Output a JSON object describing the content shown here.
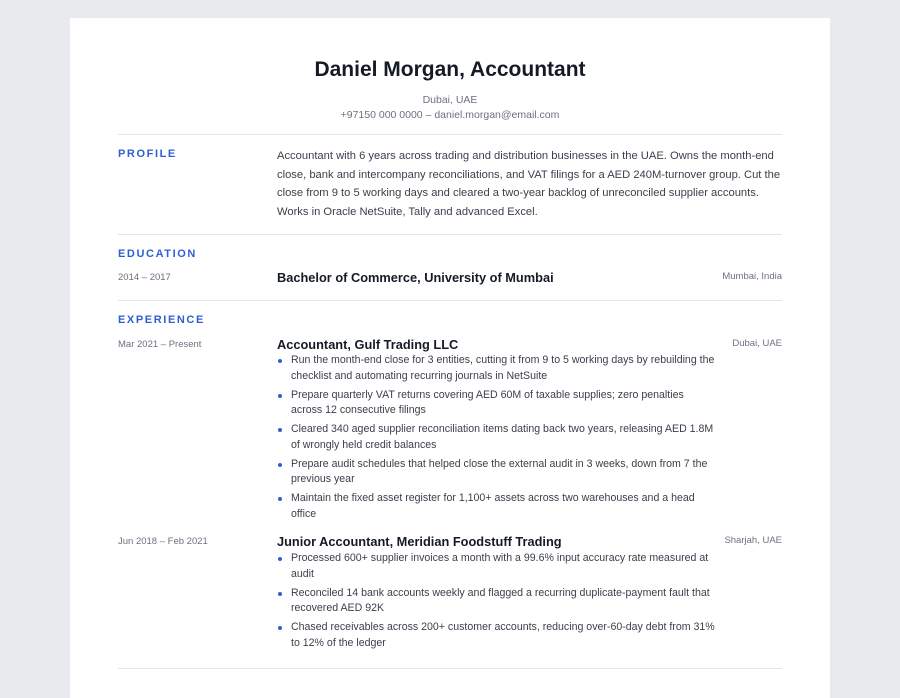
{
  "header": {
    "name": "Daniel Morgan, Accountant",
    "location": "Dubai, UAE",
    "contact": "+97150 000 0000 – daniel.morgan@email.com"
  },
  "profile": {
    "title": "PROFILE",
    "text": "Accountant with 6 years across trading and distribution businesses in the UAE. Owns the month-end close, bank and intercompany reconciliations, and VAT filings for a AED 240M-turnover group. Cut the close from 9 to 5 working days and cleared a two-year backlog of unreconciled supplier accounts. Works in Oracle NetSuite, Tally and advanced Excel."
  },
  "education": {
    "title": "EDUCATION",
    "items": [
      {
        "dates": "2014 – 2017",
        "degree": "Bachelor of Commerce, University of Mumbai",
        "location": "Mumbai, India"
      }
    ]
  },
  "experience": {
    "title": "EXPERIENCE",
    "jobs": [
      {
        "dates": "Mar 2021 – Present",
        "role": "Accountant, Gulf Trading LLC",
        "location": "Dubai, UAE",
        "bullets": [
          "Run the month-end close for 3 entities, cutting it from 9 to 5 working days by rebuilding the checklist and automating recurring journals in NetSuite",
          "Prepare quarterly VAT returns covering AED 60M of taxable supplies; zero penalties across 12 consecutive filings",
          "Cleared 340 aged supplier reconciliation items dating back two years, releasing AED 1.8M of wrongly held credit balances",
          "Prepare audit schedules that helped close the external audit in 3 weeks, down from 7 the previous year",
          "Maintain the fixed asset register for 1,100+ assets across two warehouses and a head office"
        ]
      },
      {
        "dates": "Jun 2018 – Feb 2021",
        "role": "Junior Accountant, Meridian Foodstuff Trading",
        "location": "Sharjah, UAE",
        "bullets": [
          "Processed 600+ supplier invoices a month with a 99.6% input accuracy rate measured at audit",
          "Reconciled 14 bank accounts weekly and flagged a recurring duplicate-payment fault that recovered AED 92K",
          "Chased receivables across 200+ customer accounts, reducing over-60-day debt from 31% to 12% of the ledger"
        ]
      }
    ]
  }
}
